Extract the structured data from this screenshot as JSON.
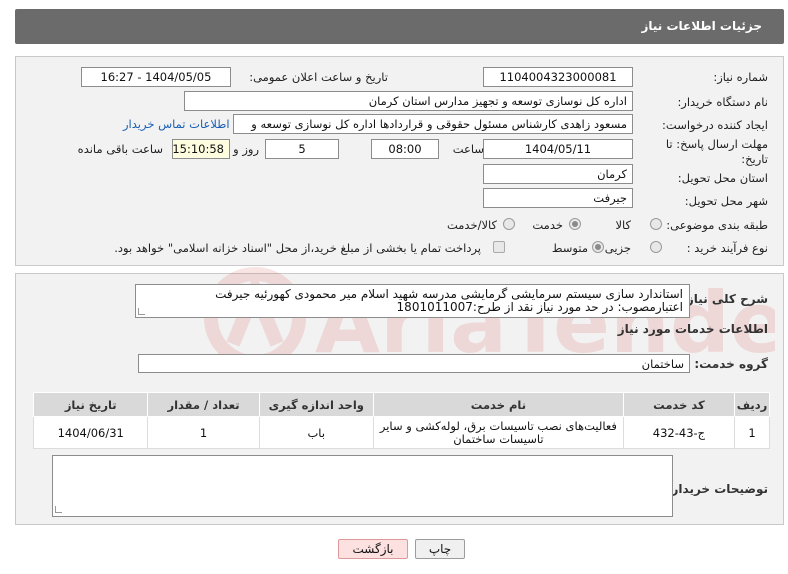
{
  "header": {
    "title": "جزئیات اطلاعات نیاز"
  },
  "form": {
    "need_number_label": "شماره نیاز:",
    "need_number_value": "1104004323000081",
    "announce_label": "تاریخ و ساعت اعلان عمومی:",
    "announce_value": "1404/05/05 - 16:27",
    "buyer_org_label": "نام دستگاه خریدار:",
    "buyer_org_value": "اداره کل نوسازی  توسعه و تجهیز مدارس استان کرمان",
    "creator_label": "ایجاد کننده درخواست:",
    "creator_value": "مسعود زاهدی کارشناس مسئول حقوقی و قراردادها اداره کل نوسازی  توسعه و",
    "contact_link": "اطلاعات تماس خریدار",
    "deadline_label_1": "مهلت ارسال پاسخ: تا",
    "deadline_label_2": "تاریخ:",
    "deadline_date": "1404/05/11",
    "time_label": "ساعت",
    "deadline_time": "08:00",
    "days_value": "5",
    "days_label": "روز و",
    "remaining_time": "15:10:58",
    "remaining_label": "ساعت باقی مانده",
    "province_label": "استان محل تحویل:",
    "province_value": "کرمان",
    "city_label": "شهر محل تحویل:",
    "city_value": "جیرفت",
    "category_label": "طبقه بندی موضوعی:",
    "category_options": [
      "کالا",
      "خدمت",
      "کالا/خدمت"
    ],
    "process_label": "نوع فرآیند خرید :",
    "process_options": [
      "جزیی",
      "متوسط"
    ],
    "payment_note": "پرداخت تمام یا بخشی از مبلغ خرید،از محل \"اسناد خزانه اسلامی\" خواهد بود."
  },
  "description": {
    "label": "شرح کلی نیاز:",
    "line1": "استاندارد سازی سیستم سرمایشی گرمایشی مدرسه شهید اسلام میر محمودی کهورئیه جیرفت",
    "line2": "اعتبارمصوب: در حد مورد نیاز نقد   از طرح:1801011007"
  },
  "services": {
    "section_title": "اطلاعات خدمات مورد نیاز",
    "group_label": "گروه خدمت:",
    "group_value": "ساختمان",
    "columns": [
      "ردیف",
      "کد خدمت",
      "نام خدمت",
      "واحد اندازه گیری",
      "تعداد / مقدار",
      "تاریخ نیاز"
    ],
    "rows": [
      {
        "index": "1",
        "code": "ج-43-432",
        "name": "فعالیت‌های نصب تاسیسات برق، لوله‌کشی و سایر تاسیسات ساختمان",
        "unit": "باب",
        "qty": "1",
        "date": "1404/06/31"
      }
    ]
  },
  "buyer_notes": {
    "label": "توضیحات خریدار:",
    "value": ""
  },
  "buttons": {
    "print": "چاپ",
    "back": "بازگشت"
  },
  "watermark": {
    "text": "AriaTender.neT"
  },
  "colors": {
    "header_bg": "#6b6b6b",
    "panel_bg": "#f2f2f2",
    "link": "#1a5fb4",
    "watermark": "#d0352b"
  }
}
